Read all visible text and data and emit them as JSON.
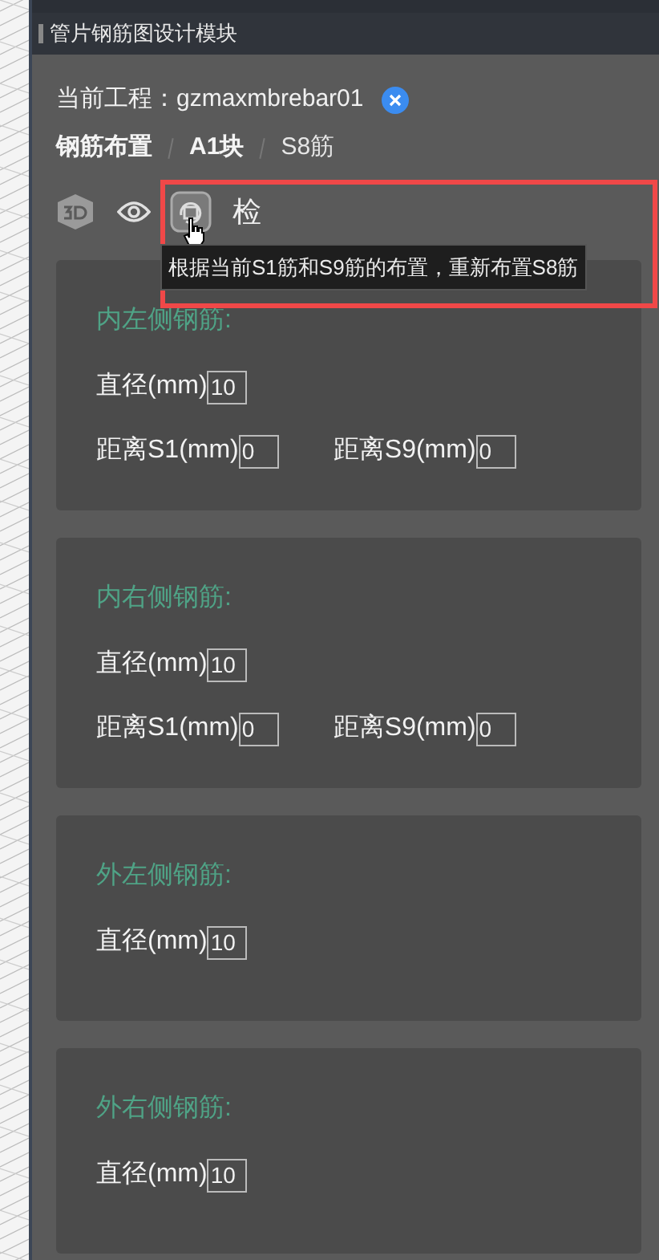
{
  "panel": {
    "title": "管片钢筋图设计模块"
  },
  "project": {
    "label": "当前工程：",
    "name": "gzmaxmbrebar01"
  },
  "breadcrumb": [
    {
      "label": "钢筋布置",
      "selected": false
    },
    {
      "label": "A1块",
      "selected": false
    },
    {
      "label": "S8筋",
      "selected": true
    }
  ],
  "toolbar": [
    {
      "kind": "cube"
    },
    {
      "kind": "eye"
    },
    {
      "kind": "recheck",
      "hovered": true
    },
    {
      "kind": "text",
      "label": "检"
    }
  ],
  "tooltip": "根据当前S1筋和S9筋的布置，重新布置S8筋",
  "sections": [
    {
      "title": "内左侧钢筋:",
      "rows": [
        [
          {
            "label": "直径(mm)",
            "value": "10"
          }
        ],
        [
          {
            "label": "距离S1(mm)",
            "value": "0"
          },
          {
            "label": "距离S9(mm)",
            "value": "0"
          }
        ]
      ]
    },
    {
      "title": "内右侧钢筋:",
      "rows": [
        [
          {
            "label": "直径(mm)",
            "value": "10"
          }
        ],
        [
          {
            "label": "距离S1(mm)",
            "value": "0"
          },
          {
            "label": "距离S9(mm)",
            "value": "0"
          }
        ]
      ]
    },
    {
      "title": "外左侧钢筋:",
      "rows": [
        [
          {
            "label": "直径(mm)",
            "value": "10"
          }
        ]
      ]
    },
    {
      "title": "外右侧钢筋:",
      "rows": [
        [
          {
            "label": "直径(mm)",
            "value": "10"
          }
        ]
      ]
    }
  ]
}
